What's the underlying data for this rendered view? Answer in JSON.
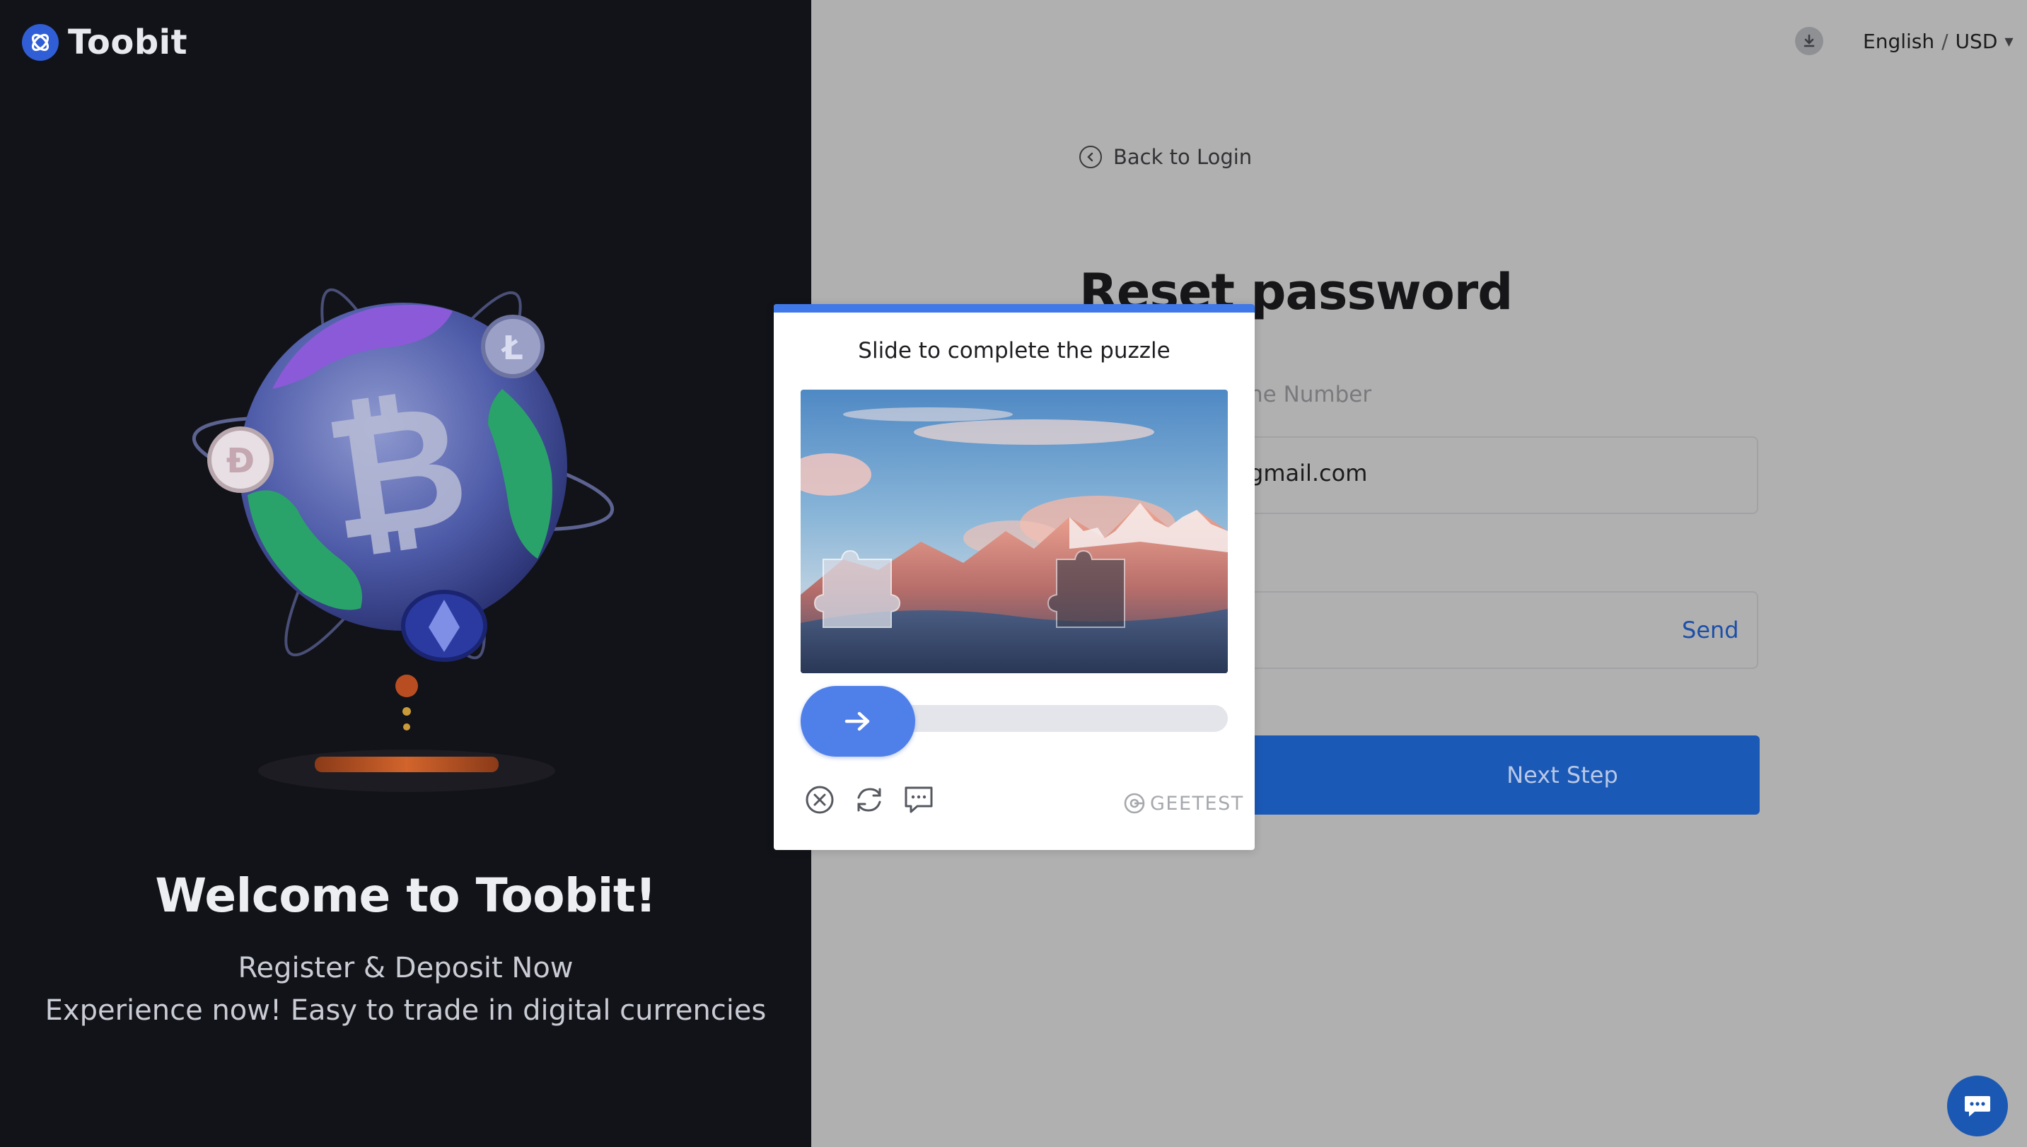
{
  "brand": {
    "name": "Toobit",
    "accent": "#1b59b6"
  },
  "hero": {
    "title": "Welcome to Toobit!",
    "subtitle_1": "Register & Deposit Now",
    "subtitle_2": "Experience now! Easy to trade in digital currencies"
  },
  "topbar": {
    "download_icon": "download-icon",
    "language": "English",
    "separator": "/",
    "currency": "USD"
  },
  "form": {
    "back_label": "Back to Login",
    "title": "Reset password",
    "tab_label_visible": "ne Number",
    "email_value_visible": "gmail.com",
    "send_label": "Send",
    "next_label": "Next Step"
  },
  "captcha": {
    "title": "Slide to complete the puzzle",
    "slider_progress": 0,
    "brand": "GEETEST",
    "tools": [
      "close-icon",
      "refresh-icon",
      "feedback-icon"
    ]
  },
  "support": {
    "icon": "chat-icon"
  }
}
